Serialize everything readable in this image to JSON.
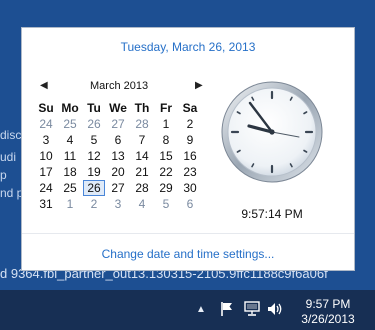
{
  "desktop": {
    "background_color": "#1d4f92",
    "partial_lines": [
      "disc",
      "udi",
      "p",
      "nd po"
    ],
    "bottom_text": "d 9364.fbl_partner_out13.130315-2105.9ffc1188c9f6a06f"
  },
  "flyout": {
    "date_header": "Tuesday, March 26, 2013",
    "month_label": "March 2013",
    "prev_symbol": "◀",
    "next_symbol": "▶",
    "weekdays": [
      "Su",
      "Mo",
      "Tu",
      "We",
      "Th",
      "Fr",
      "Sa"
    ],
    "weeks": [
      [
        "24",
        "25",
        "26",
        "27",
        "28",
        "1",
        "2"
      ],
      [
        "3",
        "4",
        "5",
        "6",
        "7",
        "8",
        "9"
      ],
      [
        "10",
        "11",
        "12",
        "13",
        "14",
        "15",
        "16"
      ],
      [
        "17",
        "18",
        "19",
        "20",
        "21",
        "22",
        "23"
      ],
      [
        "24",
        "25",
        "26",
        "27",
        "28",
        "29",
        "30"
      ],
      [
        "31",
        "1",
        "2",
        "3",
        "4",
        "5",
        "6"
      ]
    ],
    "clock_time": "9:57:14 PM",
    "change_link": "Change date and time settings..."
  },
  "taskbar": {
    "show_hidden_symbol": "▲",
    "time": "9:57 PM",
    "date": "3/26/2013",
    "icons": [
      "action-center-flag-icon",
      "network-icon",
      "volume-icon"
    ]
  }
}
